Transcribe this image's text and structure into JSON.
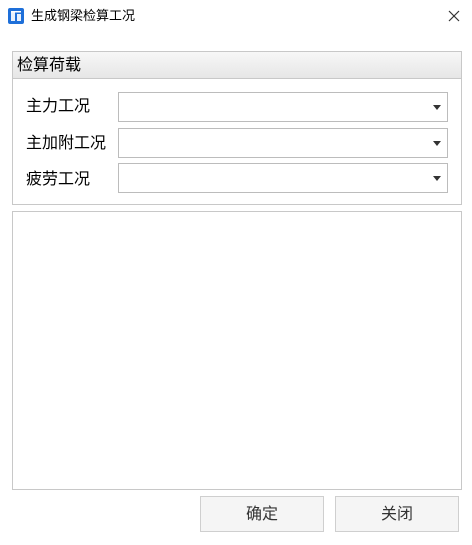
{
  "window": {
    "title": "生成钢梁检算工况",
    "icon": "app-icon",
    "close_icon": "close-icon"
  },
  "group": {
    "title": "检算荷载",
    "rows": [
      {
        "label": "主力工况",
        "value": ""
      },
      {
        "label": "主加附工况",
        "value": ""
      },
      {
        "label": "疲劳工况",
        "value": ""
      }
    ]
  },
  "buttons": {
    "confirm": "确定",
    "close": "关闭"
  }
}
